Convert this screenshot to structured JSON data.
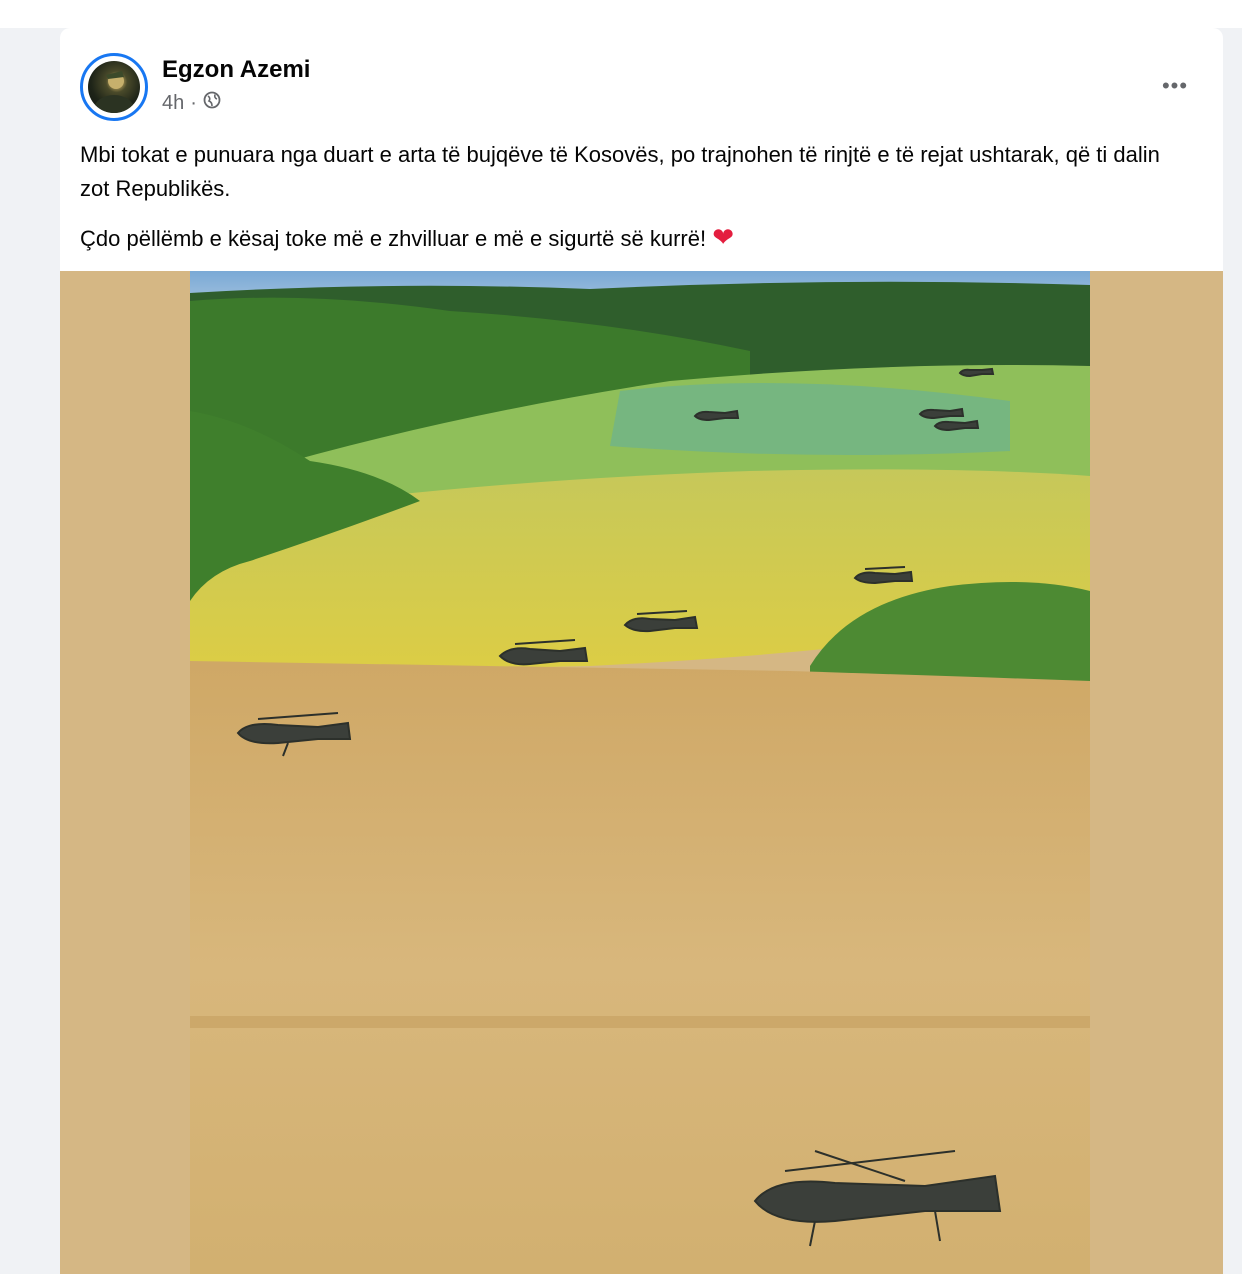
{
  "post": {
    "author": "Egzon Azemi",
    "time": "4h",
    "separator": "·",
    "privacy_icon": "globe-icon",
    "more_label": "•••",
    "text_line1": "Mbi tokat e punuara nga duart e arta të bujqëve të Kosovës, po trajnohen të rinjtë e të rejat ushtarak, që ti dalin zot Republikës.",
    "text_line2": "Çdo pëllëmb e kësaj toke më e zhvilluar e më e sigurtë së kurrë!",
    "emoji": "heart-emoji"
  },
  "colors": {
    "accent": "#1877f2",
    "heart": "#e41e3f",
    "media_bg": "#d5b784"
  }
}
